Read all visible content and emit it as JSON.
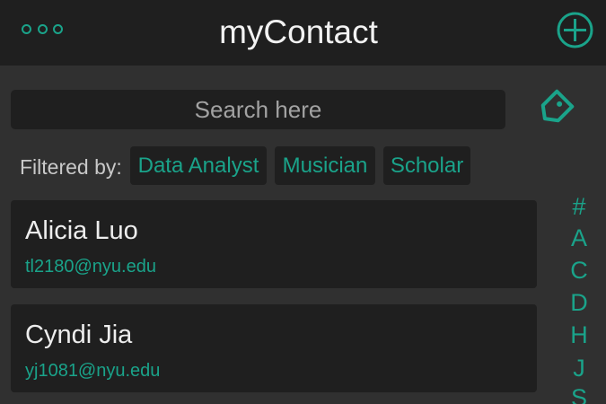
{
  "app": {
    "title": "myContact"
  },
  "colors": {
    "accent": "#1aa38a",
    "header_bg": "#1f1f1f",
    "page_bg": "#303030",
    "card_bg": "#1f1f1f"
  },
  "header": {
    "menu_icon": "more-dots-icon",
    "add_icon": "add-circle-icon"
  },
  "search": {
    "placeholder": "Search here",
    "value": "",
    "tag_icon": "tag-icon"
  },
  "filter": {
    "label": "Filtered by:",
    "tags": [
      "Data Analyst",
      "Musician",
      "Scholar"
    ]
  },
  "contacts": [
    {
      "name": "Alicia Luo",
      "email": "tl2180@nyu.edu"
    },
    {
      "name": "Cyndi Jia",
      "email": "yj1081@nyu.edu"
    }
  ],
  "alphabet_index": [
    "#",
    "A",
    "C",
    "D",
    "H",
    "J",
    "S"
  ]
}
